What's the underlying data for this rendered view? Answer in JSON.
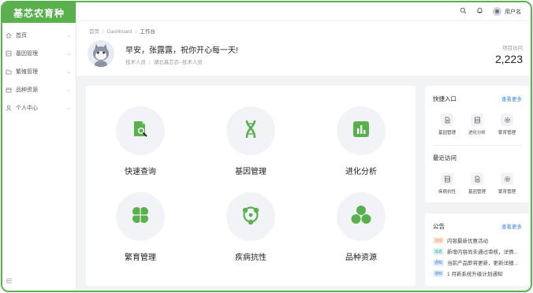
{
  "app": {
    "brand": "基芯农育种"
  },
  "sidebar": {
    "items": [
      {
        "label": "首页",
        "icon": "home-icon"
      },
      {
        "label": "基因管理",
        "icon": "dna-icon"
      },
      {
        "label": "繁殖管理",
        "icon": "folder-icon"
      },
      {
        "label": "品种资源",
        "icon": "box-icon"
      },
      {
        "label": "个人中心",
        "icon": "user-icon"
      }
    ]
  },
  "topbar": {
    "username": "用户名"
  },
  "breadcrumb": {
    "items": [
      "首页",
      "Dashboard",
      "工作台"
    ]
  },
  "header": {
    "greeting": "早安，张露露，祝你开心每一天!",
    "role": "技术人员",
    "org": "湖北基芯农–技术人员",
    "visits_label": "项目访问",
    "visits_value": "2,223"
  },
  "features": [
    {
      "label": "快速查询",
      "icon": "search-doc-icon"
    },
    {
      "label": "基因管理",
      "icon": "dna-icon"
    },
    {
      "label": "进化分析",
      "icon": "bar-chart-icon"
    },
    {
      "label": "繁育管理",
      "icon": "clover-icon"
    },
    {
      "label": "疾病抗性",
      "icon": "nodes-icon"
    },
    {
      "label": "品种资源",
      "icon": "circles-icon"
    }
  ],
  "quick": {
    "title": "快捷入口",
    "more": "查看更多",
    "items": [
      {
        "label": "基因管理",
        "icon": "document-icon"
      },
      {
        "label": "进化分析",
        "icon": "list-icon"
      },
      {
        "label": "繁育管理",
        "icon": "gear-icon"
      }
    ]
  },
  "recent": {
    "title": "最近访问",
    "items": [
      {
        "label": "疾病抗性",
        "icon": "list-icon"
      },
      {
        "label": "基因管理",
        "icon": "document-icon"
      },
      {
        "label": "繁育管理",
        "icon": "gear-icon"
      }
    ]
  },
  "notices": {
    "title": "公告",
    "more": "查看更多",
    "items": [
      {
        "tag": "活动",
        "text": "内容最新优惠活动",
        "tag_color": "#f07b3f",
        "tag_bg": "#fdeee4"
      },
      {
        "tag": "消息",
        "text": "新增内容尚未通过审核，详情...",
        "tag_color": "#27a39a",
        "tag_bg": "#e2f5f3"
      },
      {
        "tag": "通知",
        "text": "当前产品即将更新，更新详细...",
        "tag_color": "#3a86d8",
        "tag_bg": "#e6f0fb"
      },
      {
        "tag": "通知",
        "text": "1 月新系统升级计划通知",
        "tag_color": "#3a86d8",
        "tag_bg": "#e6f0fb"
      }
    ]
  },
  "colors": {
    "brand": "#5bb04e",
    "link": "#3a86d8"
  }
}
